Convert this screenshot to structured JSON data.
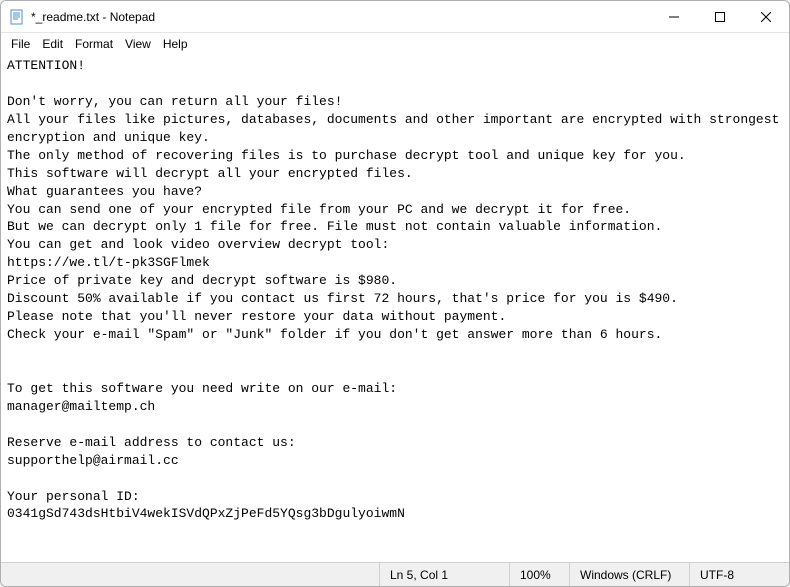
{
  "window": {
    "title": "*_readme.txt - Notepad"
  },
  "menu": {
    "file": "File",
    "edit": "Edit",
    "format": "Format",
    "view": "View",
    "help": "Help"
  },
  "content": {
    "body": "ATTENTION!\n\nDon't worry, you can return all your files!\nAll your files like pictures, databases, documents and other important are encrypted with strongest encryption and unique key.\nThe only method of recovering files is to purchase decrypt tool and unique key for you.\nThis software will decrypt all your encrypted files.\nWhat guarantees you have?\nYou can send one of your encrypted file from your PC and we decrypt it for free.\nBut we can decrypt only 1 file for free. File must not contain valuable information.\nYou can get and look video overview decrypt tool:\nhttps://we.tl/t-pk3SGFlmek\nPrice of private key and decrypt software is $980.\nDiscount 50% available if you contact us first 72 hours, that's price for you is $490.\nPlease note that you'll never restore your data without payment.\nCheck your e-mail \"Spam\" or \"Junk\" folder if you don't get answer more than 6 hours.\n\n\nTo get this software you need write on our e-mail:\nmanager@mailtemp.ch\n\nReserve e-mail address to contact us:\nsupporthelp@airmail.cc\n\nYour personal ID:\n0341gSd743dsHtbiV4wekISVdQPxZjPeFd5YQsg3bDgulyoiwmN"
  },
  "status": {
    "position": "Ln 5, Col 1",
    "zoom": "100%",
    "lineEnding": "Windows (CRLF)",
    "encoding": "UTF-8"
  }
}
